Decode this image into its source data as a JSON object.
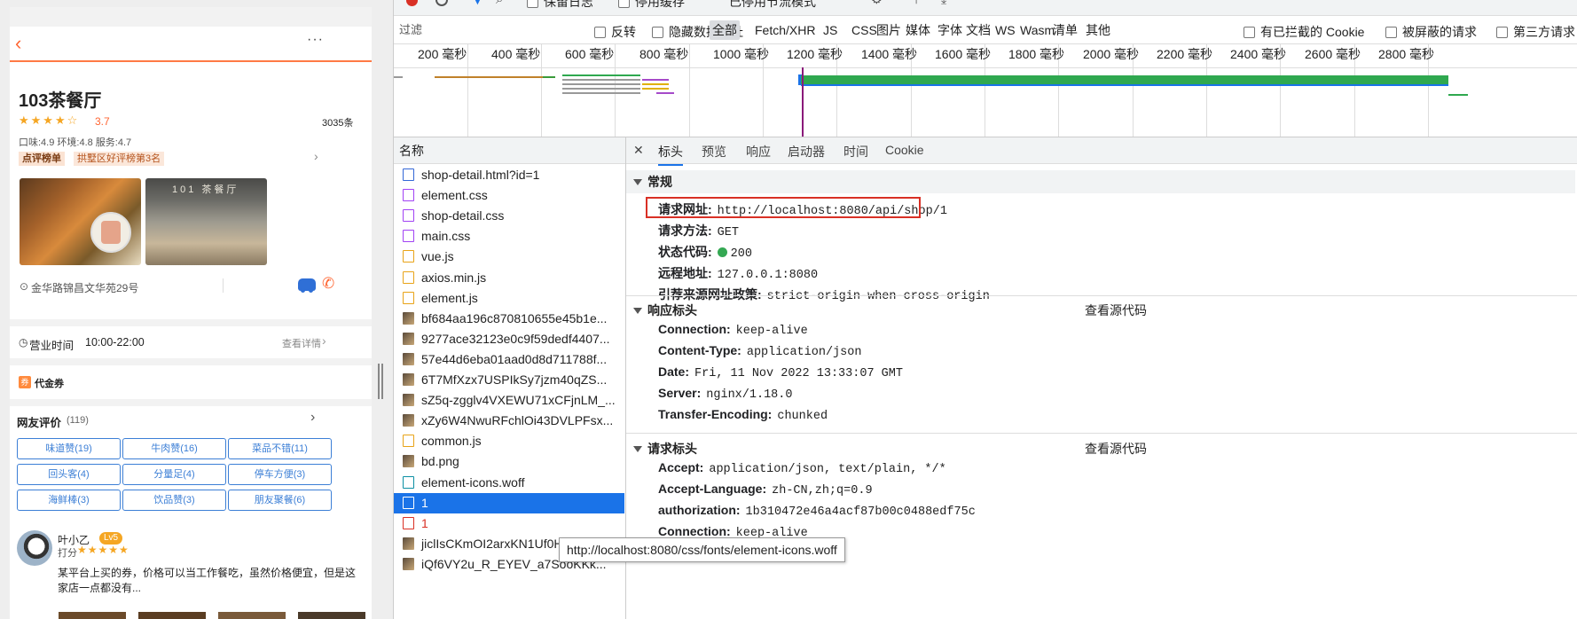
{
  "shop": {
    "name": "103茶餐厅",
    "rating": "3.7",
    "review_count": "3035条",
    "sub_scores": "口味:4.9 环境:4.8 服务:4.7",
    "rank_badge": "点评榜单",
    "rank_text": "拱墅区好评榜第3名",
    "photo2_sign": "101 茶餐厅",
    "address": "金华路锦昌文华苑29号",
    "hours_label": "营业时间",
    "hours_value": "10:00-22:00",
    "hours_detail": "查看详情",
    "coupon_icon": "券",
    "coupon_label": "代金券",
    "reviews_title": "网友评价",
    "reviews_count": "(119)",
    "tags": [
      "味道赞(19)",
      "牛肉赞(16)",
      "菜品不错(11)",
      "回头客(4)",
      "分量足(4)",
      "停车方便(3)",
      "海鲜棒(3)",
      "饮品赞(3)",
      "朋友聚餐(6)"
    ],
    "reviewer": "叶小乙",
    "reviewer_level": "Lv5",
    "review_score_label": "打分",
    "review_text": "某平台上买的券，价格可以当工作餐吃，虽然价格便宜，但是这家店一点都没有..."
  },
  "devtools": {
    "top_partial": [
      "保留日志",
      "停用缓存",
      "已停用节流模式"
    ],
    "filter_placeholder": "过滤",
    "filter_opts": [
      "反转",
      "隐藏数据网址"
    ],
    "filter_types": [
      "全部",
      "Fetch/XHR",
      "JS",
      "CSS",
      "图片",
      "媒体",
      "字体",
      "文档",
      "WS",
      "Wasm",
      "清单",
      "其他"
    ],
    "filter_checks": [
      "有已拦截的 Cookie",
      "被屏蔽的请求",
      "第三方请求"
    ],
    "ticks": [
      "200 毫秒",
      "400 毫秒",
      "600 毫秒",
      "800 毫秒",
      "1000 毫秒",
      "1200 毫秒",
      "1400 毫秒",
      "1600 毫秒",
      "1800 毫秒",
      "2000 毫秒",
      "2200 毫秒",
      "2400 毫秒",
      "2600 毫秒",
      "2800 毫秒"
    ],
    "name_col": "名称",
    "requests": [
      {
        "name": "shop-detail.html?id=1",
        "type": "doc"
      },
      {
        "name": "element.css",
        "type": "css"
      },
      {
        "name": "shop-detail.css",
        "type": "css"
      },
      {
        "name": "main.css",
        "type": "css"
      },
      {
        "name": "vue.js",
        "type": "js"
      },
      {
        "name": "axios.min.js",
        "type": "js"
      },
      {
        "name": "element.js",
        "type": "js"
      },
      {
        "name": "bf684aa196c870810655e45b1e...",
        "type": "img"
      },
      {
        "name": "9277ace32123e0c9f59dedf4407...",
        "type": "img"
      },
      {
        "name": "57e44d6eba01aad0d8d711788f...",
        "type": "img"
      },
      {
        "name": "6T7MfXzx7USPIkSy7jzm40qZS...",
        "type": "img"
      },
      {
        "name": "sZ5q-zgglv4VXEWU71xCFjnLM_...",
        "type": "img"
      },
      {
        "name": "xZy6W4NwuRFchlOi43DVLPFsx...",
        "type": "img"
      },
      {
        "name": "common.js",
        "type": "js"
      },
      {
        "name": "bd.png",
        "type": "img"
      },
      {
        "name": "element-icons.woff",
        "type": "font"
      },
      {
        "name": "1",
        "type": "selected"
      },
      {
        "name": "1",
        "type": "error"
      },
      {
        "name": "jiclIsCKmOI2arxKN1Uf0Hx3Pucl...",
        "type": "img"
      },
      {
        "name": "iQf6VY2u_R_EYEV_a7SooKKk...",
        "type": "img"
      }
    ],
    "tabs": [
      "标头",
      "预览",
      "响应",
      "启动器",
      "时间",
      "Cookie"
    ],
    "close_glyph": "✕",
    "general_title": "常规",
    "general": [
      {
        "k": "请求网址:",
        "v": "http://localhost:8080/api/shop/1"
      },
      {
        "k": "请求方法:",
        "v": "GET"
      },
      {
        "k": "状态代码:",
        "v": "200"
      },
      {
        "k": "远程地址:",
        "v": "127.0.0.1:8080"
      },
      {
        "k": "引荐来源网址政策:",
        "v": "strict-origin-when-cross-origin"
      }
    ],
    "resp_title": "响应标头",
    "view_source": "查看源代码",
    "resp": [
      {
        "k": "Connection:",
        "v": "keep-alive"
      },
      {
        "k": "Content-Type:",
        "v": "application/json"
      },
      {
        "k": "Date:",
        "v": "Fri, 11 Nov 2022 13:33:07 GMT"
      },
      {
        "k": "Server:",
        "v": "nginx/1.18.0"
      },
      {
        "k": "Transfer-Encoding:",
        "v": "chunked"
      }
    ],
    "req_title": "请求标头",
    "req": [
      {
        "k": "Accept:",
        "v": "application/json, text/plain, */*"
      },
      {
        "k": "Accept-Language:",
        "v": "zh-CN,zh;q=0.9"
      },
      {
        "k": "authorization:",
        "v": "1b310472e46a4acf87b00c0488edf75c"
      },
      {
        "k": "Connection:",
        "v": "keep-alive"
      }
    ],
    "tooltip": "http://localhost:8080/css/fonts/element-icons.woff",
    "colors": {
      "accent": "#1a73e8",
      "error": "#d93025",
      "highlight_box": "#d93025",
      "selected_row": "#1a73e8"
    }
  }
}
